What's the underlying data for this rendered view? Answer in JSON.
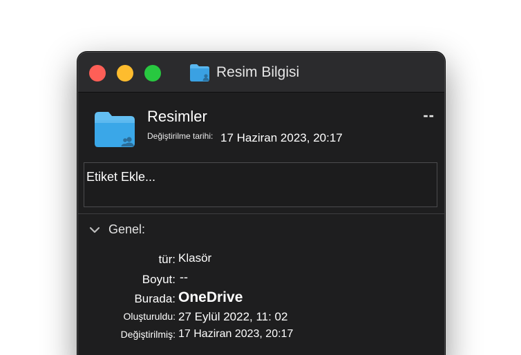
{
  "window": {
    "title": "Resim Bilgisi",
    "title_icon": "folder-icon"
  },
  "traffic_lights": {
    "close_color": "#fe5f57",
    "minimize_color": "#febc2e",
    "maximize_color": "#28c840"
  },
  "header": {
    "name": "Resimler",
    "modified_label": "Değiştirilme tarihi:",
    "modified_value": "17 Haziran 2023, 20:17",
    "size_short": "--",
    "icon": "shared-folder-icon"
  },
  "tags": {
    "placeholder": "Etiket Ekle..."
  },
  "general": {
    "section_label": "Genel:",
    "rows": [
      {
        "label": "tür:",
        "value": "Klasör"
      },
      {
        "label": "Boyut:",
        "value": "--"
      },
      {
        "label": "Burada:",
        "value": "OneDrive"
      },
      {
        "label": "Oluşturuldu:",
        "value": "27 Eylül 2022, 11: 02"
      },
      {
        "label": "Değiştirilmiş:",
        "value": "17 Haziran 2023, 20:17"
      }
    ]
  },
  "colors": {
    "window_bg": "#1e1e1f",
    "titlebar_bg": "#2b2b2d",
    "folder_blue": "#3aa7e8"
  }
}
